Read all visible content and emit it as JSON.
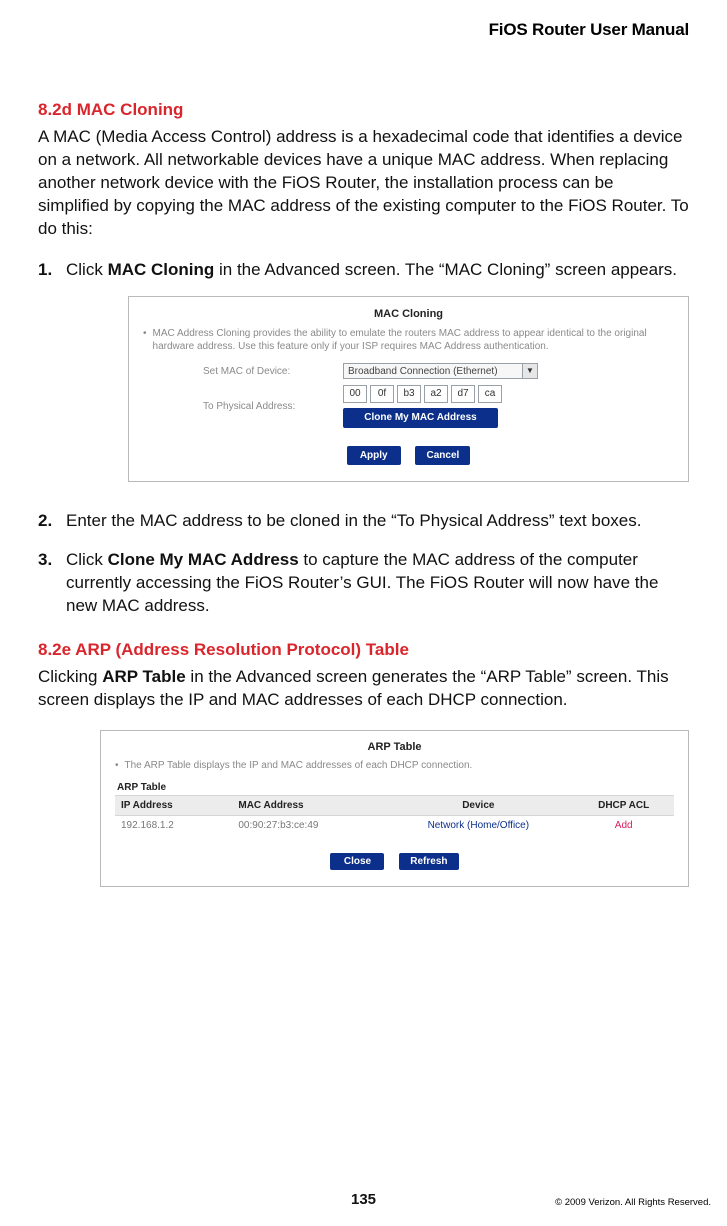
{
  "doc": {
    "header": "FiOS Router User Manual",
    "page_number": "135",
    "copyright": "© 2009 Verizon. All Rights Reserved."
  },
  "sec_82d": {
    "heading": "8.2d  MAC Cloning",
    "intro": "A MAC (Media Access Control) address is a hexadecimal code that identifies a device on a network. All networkable devices have a unique MAC address. When replacing another network device with the FiOS Router, the installation process can be simplified by copying the MAC address of the existing computer to the FiOS Router. To do this:",
    "step1_pre": "Click ",
    "step1_bold": "MAC Cloning",
    "step1_post": " in the Advanced screen. The “MAC Cloning” screen appears.",
    "step2": "Enter the MAC address to be cloned in the “To Physical Address” text boxes.",
    "step3_pre": "Click ",
    "step3_bold": "Clone My MAC Address",
    "step3_post": " to capture the MAC address of the computer currently accessing the FiOS Router’s GUI. The FiOS Router will now have the new MAC address."
  },
  "mac_panel": {
    "title": "MAC Cloning",
    "note": "MAC Address Cloning provides the ability to emulate the routers MAC address to appear identical to the original hardware address. Use this feature only if your ISP requires MAC Address authentication.",
    "label_set": "Set MAC of Device:",
    "label_to": "To Physical Address:",
    "select_value": "Broadband Connection (Ethernet)",
    "mac_octets": [
      "00",
      "0f",
      "b3",
      "a2",
      "d7",
      "ca"
    ],
    "btn_clone": "Clone My MAC Address",
    "btn_apply": "Apply",
    "btn_cancel": "Cancel"
  },
  "sec_82e": {
    "heading": "8.2e  ARP (Address Resolution Protocol) Table",
    "intro_pre": "Clicking ",
    "intro_bold": "ARP Table",
    "intro_post": " in the Advanced screen generates the “ARP Table” screen. This screen displays the IP and MAC addresses of each DHCP connection."
  },
  "arp_panel": {
    "title": "ARP Table",
    "note": "The ARP Table displays the IP and MAC addresses of each DHCP connection.",
    "subhead": "ARP Table",
    "headers": {
      "ip": "IP Address",
      "mac": "MAC Address",
      "device": "Device",
      "acl": "DHCP ACL"
    },
    "rows": [
      {
        "ip": "192.168.1.2",
        "mac": "00:90:27:b3:ce:49",
        "device": "Network (Home/Office)",
        "acl": "Add"
      }
    ],
    "btn_close": "Close",
    "btn_refresh": "Refresh"
  }
}
